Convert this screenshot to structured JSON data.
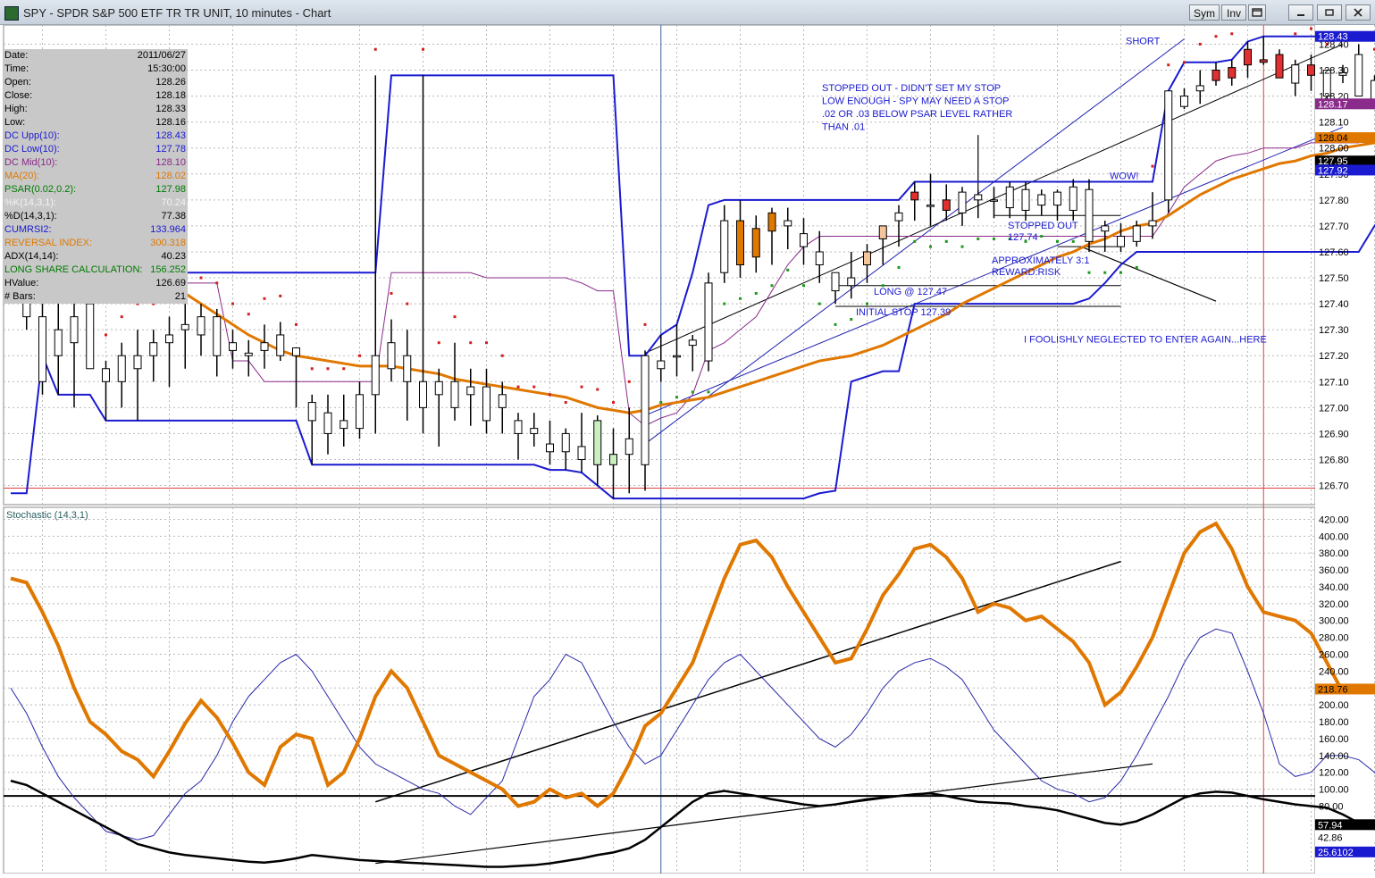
{
  "window": {
    "title": "SPY - SPDR S&P 500 ETF TR TR UNIT, 10 minutes - Chart",
    "buttons": [
      "Sym",
      "Inv"
    ],
    "controls": [
      "minimize-icon",
      "restore-icon",
      "close-icon"
    ]
  },
  "info_panel": [
    {
      "label": "Date:",
      "value": "2011/06/27",
      "color": "#000000"
    },
    {
      "label": "Time:",
      "value": "15:30:00",
      "color": "#000000"
    },
    {
      "label": "Open:",
      "value": "128.26",
      "color": "#000000"
    },
    {
      "label": "Close:",
      "value": "128.18",
      "color": "#000000"
    },
    {
      "label": "High:",
      "value": "128.33",
      "color": "#000000"
    },
    {
      "label": "Low:",
      "value": "128.16",
      "color": "#000000"
    },
    {
      "label": "DC Upp(10):",
      "value": "128.43",
      "color": "#1a1ad0"
    },
    {
      "label": "DC Low(10):",
      "value": "127.78",
      "color": "#1a1ad0"
    },
    {
      "label": "DC Mid(10):",
      "value": "128.10",
      "color": "#8a2a8a"
    },
    {
      "label": "MA(20):",
      "value": "128.02",
      "color": "#e07800"
    },
    {
      "label": "PSAR(0.02,0.2):",
      "value": "127.98",
      "color": "#007a00"
    },
    {
      "label": "%K(14,3,1):",
      "value": "70.24",
      "color": "#f2f2f2"
    },
    {
      "label": "%D(14,3,1):",
      "value": "77.38",
      "color": "#000000"
    },
    {
      "label": "CUMRSI2:",
      "value": "133.964",
      "color": "#1a1ad0"
    },
    {
      "label": "REVERSAL INDEX:",
      "value": "300.318",
      "color": "#e07800"
    },
    {
      "label": "ADX(14,14):",
      "value": "40.23",
      "color": "#000000"
    },
    {
      "label": "LONG SHARE CALCULATION:",
      "value": "156.252",
      "color": "#007a00"
    },
    {
      "label": "HValue:",
      "value": "126.69",
      "color": "#000000"
    },
    {
      "label": "# Bars:",
      "value": "21",
      "color": "#000000"
    }
  ],
  "price_axis": {
    "ticks": [
      "128.40",
      "128.30",
      "128.20",
      "128.10",
      "128.00",
      "127.90",
      "127.80",
      "127.70",
      "127.60",
      "127.50",
      "127.40",
      "127.30",
      "127.20",
      "127.10",
      "127.00",
      "126.90",
      "126.80",
      "126.70"
    ],
    "min": 126.64,
    "max": 128.46,
    "badges": [
      {
        "value": "128.43",
        "price": 128.43,
        "bg": "#1a1ad0",
        "fg": "#ffffff"
      },
      {
        "value": "128.17",
        "price": 128.17,
        "bg": "#8a2a8a",
        "fg": "#ffffff"
      },
      {
        "value": "128.04",
        "price": 128.04,
        "bg": "#e07800",
        "fg": "#000000"
      },
      {
        "value": "127.95",
        "price": 127.95,
        "bg": "#000000",
        "fg": "#ffffff"
      },
      {
        "value": "127.92",
        "price": 127.915,
        "bg": "#1a1ad0",
        "fg": "#ffffff"
      }
    ]
  },
  "stoch_panel": {
    "title": "Stochastic (14,3,1)",
    "ticks": [
      "420.00",
      "400.00",
      "380.00",
      "360.00",
      "340.00",
      "320.00",
      "300.00",
      "280.00",
      "260.00",
      "240.00",
      "220.00",
      "200.00",
      "180.00",
      "160.00",
      "140.00",
      "120.00",
      "100.00",
      "80.00"
    ],
    "min": 0,
    "max": 430,
    "badges": [
      {
        "value": "218.76",
        "v": 218.76,
        "bg": "#e07800",
        "fg": "#000000"
      },
      {
        "value": "57.94",
        "v": 57.94,
        "bg": "#000000",
        "fg": "#ffffff"
      },
      {
        "value": "42.86",
        "v": 42.86,
        "bg": "#ffffff",
        "fg": "#000000"
      },
      {
        "value": "25.6102",
        "v": 25.61,
        "bg": "#1a1ad0",
        "fg": "#ffffff"
      }
    ]
  },
  "annotations": [
    {
      "text": "STOPPED OUT - DIDN'T SET MY STOP",
      "price": 128.22,
      "col": 920
    },
    {
      "text": "LOW ENOUGH - SPY MAY NEED A STOP",
      "price": 128.17,
      "col": 920
    },
    {
      "text": ".02 OR .03 BELOW PSAR LEVEL RATHER",
      "price": 128.12,
      "col": 920
    },
    {
      "text": "THAN .01",
      "price": 128.07,
      "col": 920
    },
    {
      "text": "SHORT",
      "price": 128.4,
      "col": 1260
    },
    {
      "text": "WOW!",
      "price": 127.88,
      "col": 1242
    },
    {
      "text": "STOPPED OUT",
      "price": 127.69,
      "col": 1128
    },
    {
      "text": "127.74",
      "price": 127.645,
      "col": 1128
    },
    {
      "text": "APPROXIMATELY 3:1",
      "price": 127.555,
      "col": 1110
    },
    {
      "text": "REWARD:RISK",
      "price": 127.51,
      "col": 1110
    },
    {
      "text": "LONG @ 127.47",
      "price": 127.435,
      "col": 978
    },
    {
      "text": "INITIAL STOP 127.39",
      "price": 127.355,
      "col": 958
    },
    {
      "text": "I FOOLISHLY NEGLECTED TO ENTER AGAIN...HERE",
      "price": 127.25,
      "col": 1146
    }
  ],
  "chart_data": {
    "type": "candlestick",
    "ohlc": [
      [
        127.48,
        127.5,
        127.45,
        127.46
      ],
      [
        127.45,
        127.3,
        127.4,
        127.35
      ],
      [
        127.35,
        127.42,
        127.05,
        127.1
      ],
      [
        127.2,
        127.45,
        127.05,
        127.3
      ],
      [
        127.35,
        127.55,
        127.0,
        127.25
      ],
      [
        127.4,
        127.5,
        127.2,
        127.15
      ],
      [
        127.15,
        127.18,
        126.95,
        127.1
      ],
      [
        127.1,
        127.25,
        127.0,
        127.2
      ],
      [
        127.2,
        127.3,
        126.95,
        127.15
      ],
      [
        127.2,
        127.3,
        127.1,
        127.25
      ],
      [
        127.25,
        127.35,
        127.08,
        127.28
      ],
      [
        127.3,
        127.4,
        127.15,
        127.32
      ],
      [
        127.35,
        127.4,
        127.2,
        127.28
      ],
      [
        127.2,
        127.38,
        127.12,
        127.35
      ],
      [
        127.25,
        127.3,
        127.15,
        127.22
      ],
      [
        127.2,
        127.26,
        127.12,
        127.21
      ],
      [
        127.22,
        127.32,
        127.15,
        127.25
      ],
      [
        127.28,
        127.33,
        127.18,
        127.2
      ],
      [
        127.23,
        127.22,
        127.0,
        127.2
      ],
      [
        127.02,
        127.05,
        126.78,
        126.95
      ],
      [
        126.98,
        127.05,
        126.82,
        126.9
      ],
      [
        126.95,
        127.05,
        126.85,
        126.92
      ],
      [
        126.92,
        127.1,
        126.88,
        127.05
      ],
      [
        127.05,
        128.28,
        126.9,
        127.2
      ],
      [
        127.25,
        127.34,
        127.1,
        127.15
      ],
      [
        127.2,
        127.3,
        126.95,
        127.1
      ],
      [
        127.1,
        128.28,
        126.9,
        127.0
      ],
      [
        127.05,
        127.15,
        126.85,
        127.1
      ],
      [
        127.1,
        127.25,
        126.95,
        127.0
      ],
      [
        127.05,
        127.15,
        126.93,
        127.08
      ],
      [
        127.08,
        127.15,
        126.9,
        126.95
      ],
      [
        127.05,
        127.1,
        126.9,
        127.0
      ],
      [
        126.9,
        126.98,
        126.8,
        126.95
      ],
      [
        126.92,
        126.98,
        126.85,
        126.9
      ],
      [
        126.86,
        126.95,
        126.78,
        126.83
      ],
      [
        126.83,
        126.92,
        126.76,
        126.9
      ],
      [
        126.85,
        126.98,
        126.75,
        126.8
      ],
      [
        126.78,
        126.97,
        126.7,
        126.95
      ],
      [
        126.78,
        126.92,
        126.65,
        126.82
      ],
      [
        126.88,
        127.0,
        126.67,
        126.82
      ],
      [
        126.78,
        127.22,
        126.68,
        127.2
      ],
      [
        127.18,
        127.28,
        127.1,
        127.15
      ],
      [
        127.2,
        127.32,
        127.12,
        127.2
      ],
      [
        127.24,
        127.28,
        127.14,
        127.26
      ],
      [
        127.18,
        127.52,
        127.14,
        127.48
      ],
      [
        127.72,
        127.78,
        127.48,
        127.52
      ],
      [
        127.72,
        127.8,
        127.5,
        127.55
      ],
      [
        127.69,
        127.74,
        127.52,
        127.58
      ],
      [
        127.75,
        127.77,
        127.55,
        127.68
      ],
      [
        127.7,
        127.77,
        127.61,
        127.72
      ],
      [
        127.62,
        127.73,
        127.55,
        127.67
      ],
      [
        127.6,
        127.68,
        127.48,
        127.55
      ],
      [
        127.45,
        127.52,
        127.4,
        127.52
      ],
      [
        127.5,
        127.6,
        127.42,
        127.47
      ],
      [
        127.55,
        127.63,
        127.48,
        127.6
      ],
      [
        127.65,
        127.7,
        127.55,
        127.7
      ],
      [
        127.72,
        127.78,
        127.62,
        127.75
      ],
      [
        127.83,
        127.87,
        127.72,
        127.8
      ],
      [
        127.78,
        127.9,
        127.7,
        127.78
      ],
      [
        127.8,
        127.86,
        127.72,
        127.76
      ],
      [
        127.75,
        127.85,
        127.7,
        127.83
      ],
      [
        127.8,
        127.84,
        127.73,
        127.82
      ],
      [
        127.8,
        127.85,
        127.73,
        127.8
      ],
      [
        127.85,
        127.87,
        127.73,
        127.77
      ],
      [
        127.76,
        127.87,
        127.72,
        127.84
      ],
      [
        127.82,
        127.84,
        127.74,
        127.78
      ],
      [
        127.78,
        127.84,
        127.72,
        127.83
      ],
      [
        127.85,
        127.88,
        127.72,
        127.76
      ],
      [
        127.64,
        127.88,
        127.6,
        127.84
      ],
      [
        127.7,
        127.72,
        127.6,
        127.68
      ],
      [
        127.62,
        127.71,
        127.6,
        127.66
      ],
      [
        127.7,
        127.72,
        127.62,
        127.64
      ],
      [
        127.72,
        127.83,
        127.65,
        127.7
      ],
      [
        127.8,
        128.22,
        127.75,
        128.22
      ],
      [
        128.2,
        128.23,
        128.15,
        128.16
      ],
      [
        128.24,
        128.3,
        128.17,
        128.22
      ],
      [
        128.3,
        128.33,
        128.24,
        128.26
      ],
      [
        128.31,
        128.34,
        128.24,
        128.27
      ],
      [
        128.38,
        128.41,
        128.27,
        128.32
      ],
      [
        128.34,
        128.43,
        128.32,
        128.33
      ],
      [
        128.36,
        128.38,
        128.27,
        128.27
      ],
      [
        128.25,
        128.34,
        128.2,
        128.32
      ],
      [
        128.28,
        128.36,
        128.22,
        128.32
      ],
      [
        128.2,
        128.3,
        128.15,
        128.3
      ],
      [
        128.28,
        128.32,
        128.25,
        128.29
      ],
      [
        128.2,
        128.4,
        128.2,
        128.36
      ],
      [
        128.16,
        128.28,
        128.16,
        128.26
      ],
      [
        128.05,
        128.2,
        128.03,
        128.18
      ],
      [
        128.02,
        128.12,
        127.92,
        128.08
      ]
    ],
    "dc_upper": [
      128.27,
      128.27,
      128.27,
      128.27,
      128.27,
      128.27,
      128.27,
      128.27,
      128.27,
      128.27,
      127.95,
      127.52,
      127.52,
      127.52,
      127.52,
      127.52,
      127.52,
      127.52,
      127.52,
      127.52,
      127.52,
      127.52,
      127.52,
      127.52,
      128.28,
      128.28,
      128.28,
      128.28,
      128.28,
      128.28,
      128.28,
      128.28,
      128.28,
      128.28,
      128.28,
      128.28,
      128.28,
      128.28,
      128.28,
      127.2,
      127.2,
      127.28,
      127.32,
      127.52,
      127.78,
      127.8,
      127.8,
      127.8,
      127.8,
      127.8,
      127.8,
      127.8,
      127.8,
      127.8,
      127.8,
      127.8,
      127.8,
      127.87,
      127.87,
      127.87,
      127.87,
      127.87,
      127.87,
      127.87,
      127.87,
      127.87,
      127.87,
      127.87,
      127.87,
      127.87,
      127.87,
      127.87,
      127.87,
      128.22,
      128.33,
      128.33,
      128.33,
      128.34,
      128.41,
      128.43,
      128.43,
      128.43,
      128.43,
      128.43,
      128.43,
      128.43,
      128.43,
      128.43,
      128.43
    ],
    "dc_lower": [
      126.67,
      126.67,
      127.2,
      127.05,
      127.05,
      127.05,
      126.95,
      126.95,
      126.95,
      126.95,
      126.95,
      126.95,
      126.95,
      126.95,
      126.95,
      126.95,
      126.95,
      126.95,
      126.95,
      126.78,
      126.78,
      126.78,
      126.78,
      126.78,
      126.78,
      126.78,
      126.78,
      126.78,
      126.78,
      126.78,
      126.78,
      126.78,
      126.78,
      126.78,
      126.76,
      126.76,
      126.75,
      126.7,
      126.65,
      126.65,
      126.65,
      126.65,
      126.65,
      126.65,
      126.65,
      126.65,
      126.65,
      126.65,
      126.65,
      126.65,
      126.65,
      126.67,
      126.68,
      127.1,
      127.12,
      127.14,
      127.14,
      127.4,
      127.4,
      127.4,
      127.4,
      127.4,
      127.4,
      127.4,
      127.4,
      127.4,
      127.4,
      127.4,
      127.42,
      127.48,
      127.55,
      127.6,
      127.6,
      127.6,
      127.6,
      127.6,
      127.6,
      127.6,
      127.6,
      127.6,
      127.6,
      127.6,
      127.6,
      127.6,
      127.6,
      127.6,
      127.7,
      127.78,
      127.92
    ],
    "dc_mid": [
      127.48,
      127.48,
      127.48,
      127.48,
      127.48,
      127.48,
      127.48,
      127.48,
      127.48,
      127.48,
      127.48,
      127.48,
      127.48,
      127.48,
      127.18,
      127.18,
      127.1,
      127.1,
      127.1,
      127.1,
      127.1,
      127.1,
      127.1,
      127.1,
      127.52,
      127.52,
      127.52,
      127.52,
      127.52,
      127.52,
      127.5,
      127.5,
      127.5,
      127.5,
      127.5,
      127.5,
      127.48,
      127.45,
      127.45,
      126.98,
      126.93,
      126.96,
      126.98,
      127.05,
      127.22,
      127.25,
      127.3,
      127.35,
      127.45,
      127.55,
      127.62,
      127.66,
      127.66,
      127.66,
      127.66,
      127.66,
      127.66,
      127.66,
      127.66,
      127.66,
      127.66,
      127.66,
      127.66,
      127.66,
      127.66,
      127.66,
      127.66,
      127.66,
      127.66,
      127.66,
      127.66,
      127.66,
      127.66,
      127.75,
      127.85,
      127.9,
      127.95,
      127.97,
      127.98,
      128.0,
      128.0,
      128.0,
      128.02,
      128.02,
      128.02,
      128.02,
      128.05,
      128.1,
      128.17
    ],
    "ma20": [
      127.46,
      127.5,
      127.55,
      127.58,
      127.6,
      127.58,
      127.55,
      127.52,
      127.5,
      127.48,
      127.46,
      127.44,
      127.4,
      127.36,
      127.32,
      127.28,
      127.25,
      127.22,
      127.2,
      127.19,
      127.18,
      127.17,
      127.16,
      127.16,
      127.16,
      127.15,
      127.14,
      127.13,
      127.11,
      127.1,
      127.09,
      127.08,
      127.07,
      127.06,
      127.05,
      127.04,
      127.02,
      127.0,
      126.99,
      126.98,
      126.99,
      127.01,
      127.02,
      127.03,
      127.04,
      127.06,
      127.08,
      127.1,
      127.12,
      127.14,
      127.16,
      127.18,
      127.19,
      127.2,
      127.22,
      127.24,
      127.27,
      127.3,
      127.33,
      127.36,
      127.4,
      127.43,
      127.46,
      127.49,
      127.52,
      127.55,
      127.58,
      127.6,
      127.63,
      127.65,
      127.68,
      127.7,
      127.71,
      127.74,
      127.78,
      127.82,
      127.85,
      127.88,
      127.9,
      127.92,
      127.94,
      127.95,
      127.97,
      127.98,
      128.0,
      128.01,
      128.02,
      128.04,
      128.04
    ]
  }
}
